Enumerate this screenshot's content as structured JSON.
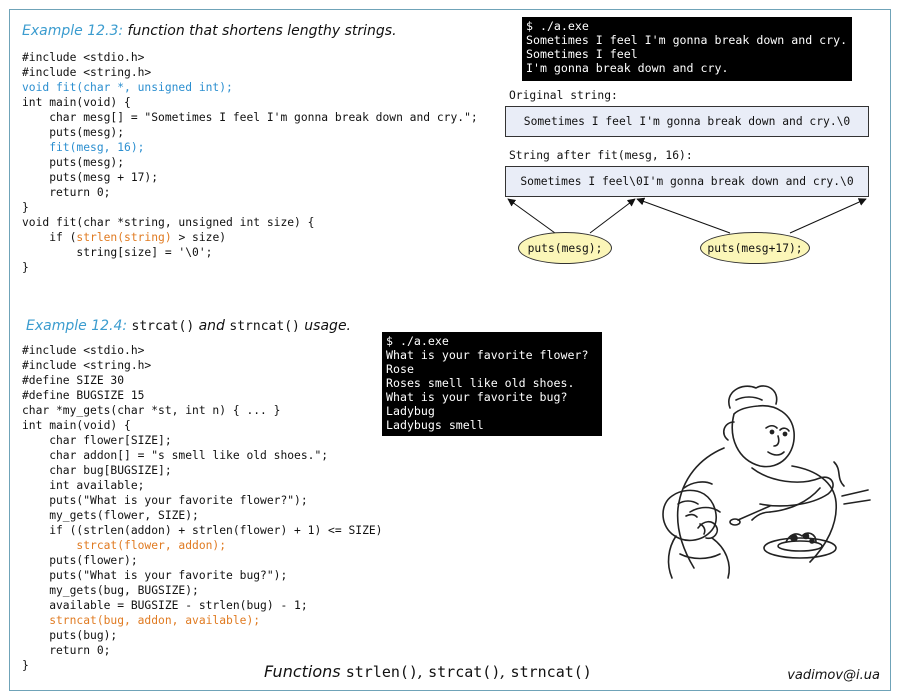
{
  "example1": {
    "number": "Example 12.3:",
    "description": " function that shortens lengthy strings.",
    "code": [
      {
        "text": "#include <stdio.h>",
        "style": ""
      },
      {
        "text": "#include <string.h>",
        "style": ""
      },
      {
        "text": "void fit(char *, unsigned int);",
        "style": "blue"
      },
      {
        "text": "int main(void) {",
        "style": ""
      },
      {
        "text": "    char mesg[] = \"Sometimes I feel I'm gonna break down and cry.\";",
        "style": ""
      },
      {
        "text": "    puts(mesg);",
        "style": ""
      },
      {
        "text": "    fit(mesg, 16);",
        "style": "blue"
      },
      {
        "text": "    puts(mesg);",
        "style": ""
      },
      {
        "text": "    puts(mesg + 17);",
        "style": ""
      },
      {
        "text": "    return 0;",
        "style": ""
      },
      {
        "text": "}",
        "style": ""
      },
      {
        "text": "void fit(char *string, unsigned int size) {",
        "style": ""
      },
      {
        "text": "    if (strlen(string) > size)",
        "style": "strlen"
      },
      {
        "text": "        string[size] = '\\0';",
        "style": ""
      },
      {
        "text": "}",
        "style": ""
      }
    ],
    "strlen_line": {
      "pre": "    if (",
      "highlight": "strlen(string)",
      "post": " > size)"
    },
    "terminal": [
      "$ ./a.exe",
      "Sometimes I feel I'm gonna break down and cry.",
      "Sometimes I feel",
      "I'm gonna break down and cry."
    ],
    "original_label": "Original string:",
    "original_string": "Sometimes I feel I'm gonna break down and cry.\\0",
    "after_label": "String after fit(mesg, 16):",
    "after_string": "Sometimes I feel\\0I'm gonna break down and cry.\\0",
    "bubble_left": "puts(mesg);",
    "bubble_right": "puts(mesg+17);"
  },
  "example2": {
    "number": "Example 12.4:",
    "func1": "strcat()",
    "and": " and ",
    "func2": "strncat()",
    "usage": " usage.",
    "code": [
      {
        "text": "#include <stdio.h>",
        "style": ""
      },
      {
        "text": "#include <string.h>",
        "style": ""
      },
      {
        "text": "#define SIZE 30",
        "style": ""
      },
      {
        "text": "#define BUGSIZE 15",
        "style": ""
      },
      {
        "text": "char *my_gets(char *st, int n) { ... }",
        "style": ""
      },
      {
        "text": "int main(void) {",
        "style": ""
      },
      {
        "text": "    char flower[SIZE];",
        "style": ""
      },
      {
        "text": "    char addon[] = \"s smell like old shoes.\";",
        "style": ""
      },
      {
        "text": "    char bug[BUGSIZE];",
        "style": ""
      },
      {
        "text": "    int available;",
        "style": ""
      },
      {
        "text": "    puts(\"What is your favorite flower?\");",
        "style": ""
      },
      {
        "text": "    my_gets(flower, SIZE);",
        "style": ""
      },
      {
        "text": "    if ((strlen(addon) + strlen(flower) + 1) <= SIZE)",
        "style": ""
      },
      {
        "text": "        strcat(flower, addon);",
        "style": "orange"
      },
      {
        "text": "    puts(flower);",
        "style": ""
      },
      {
        "text": "    puts(\"What is your favorite bug?\");",
        "style": ""
      },
      {
        "text": "    my_gets(bug, BUGSIZE);",
        "style": ""
      },
      {
        "text": "    available = BUGSIZE - strlen(bug) - 1;",
        "style": ""
      },
      {
        "text": "    strncat(bug, addon, available);",
        "style": "orange"
      },
      {
        "text": "    puts(bug);",
        "style": ""
      },
      {
        "text": "    return 0;",
        "style": ""
      },
      {
        "text": "}",
        "style": ""
      }
    ],
    "terminal": [
      "$ ./a.exe",
      "What is your favorite flower?",
      "Rose",
      "Roses smell like old shoes.",
      "What is your favorite bug?",
      "Ladybug",
      "Ladybugs smell"
    ]
  },
  "footer": {
    "functions_word": "Functions ",
    "func_list": "strlen(), strcat(), strncat()",
    "func_list_parts": [
      "strlen()",
      ", ",
      "strcat()",
      ", ",
      "strncat()"
    ],
    "signature": "vadimov@i.ua"
  },
  "colors": {
    "keyword_blue": "#2c8fd0",
    "highlight_orange": "#e07b22",
    "string_box": "#e9edf7",
    "bubble": "#fbf6b8",
    "frame": "#6fa3b8"
  },
  "illustration": {
    "icon": "mother-feeding-child-drawing-icon"
  }
}
